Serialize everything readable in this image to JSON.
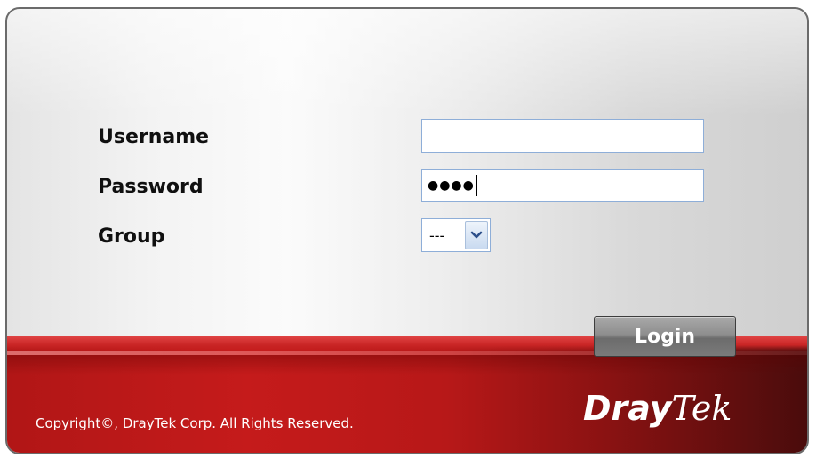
{
  "form": {
    "username_label": "Username",
    "username_value": "",
    "password_label": "Password",
    "password_value": "●●●●",
    "group_label": "Group",
    "group_selected": "---"
  },
  "actions": {
    "login_label": "Login"
  },
  "footer": {
    "copyright": "Copyright©, DrayTek Corp. All Rights Reserved.",
    "logo_dray": "Dray",
    "logo_tek": "Tek"
  },
  "icons": {
    "dropdown": "chevron-down-icon"
  },
  "colors": {
    "brand_red": "#c51b1b",
    "field_border": "#8eaed8"
  }
}
